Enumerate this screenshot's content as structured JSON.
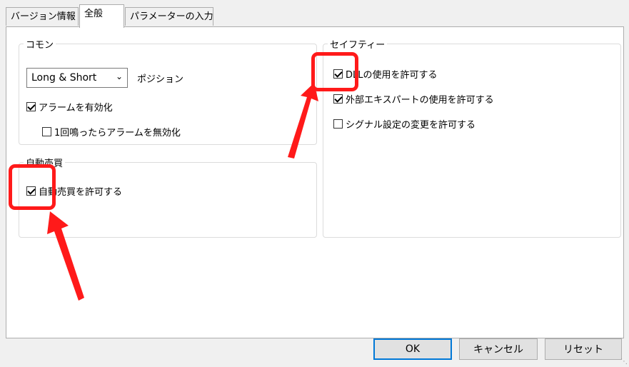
{
  "tabs": [
    "バージョン情報",
    "全般",
    "パラメーターの入力"
  ],
  "common": {
    "title": "コモン",
    "select_value": "Long & Short",
    "position_label": "ポジション",
    "alarm_enable": {
      "label": "アラームを有効化",
      "checked": true
    },
    "alarm_disable_once": {
      "label": "1回鳴ったらアラームを無効化",
      "checked": false
    }
  },
  "auto_trade": {
    "title": "自動売買",
    "allow": {
      "label": "自動売買を許可する",
      "checked": true
    }
  },
  "safety": {
    "title": "セイフティー",
    "dll": {
      "label": "DLLの使用を許可する",
      "checked": true
    },
    "external_expert": {
      "label": "外部エキスパートの使用を許可する",
      "checked": true
    },
    "signal_change": {
      "label": "シグナル設定の変更を許可する",
      "checked": false
    }
  },
  "buttons": {
    "ok": "OK",
    "cancel": "キャンセル",
    "reset": "リセット"
  },
  "colors": {
    "highlight": "#ff1a1a",
    "default_button_border": "#0078d7"
  }
}
